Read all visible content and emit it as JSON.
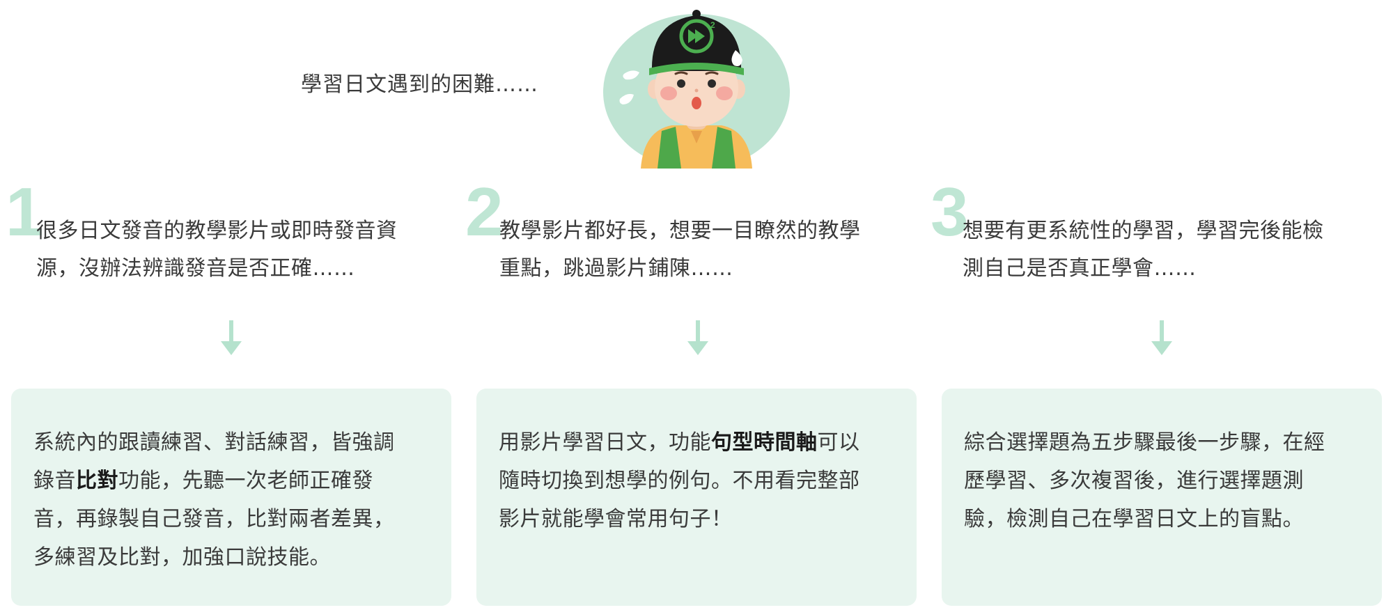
{
  "intro": "學習日文遇到的困難……",
  "colors": {
    "mint_circle": "#bfe4d3",
    "number": "#bfe6d4",
    "card_bg": "#e8f5ef",
    "arrow": "#b5e2cd",
    "hat": "#1b1b1b",
    "logo_green": "#4caf50"
  },
  "icons": {
    "avatar": "boy-with-cap-avatar",
    "arrow": "arrow-down-icon"
  },
  "columns": [
    {
      "number": "1",
      "problem_lines": [
        "很多日文發音的教學影片或即時發音資",
        "源，沒辦法辨識發音是否正確……"
      ],
      "solution": {
        "l1": "系統內的跟讀練習、對話練習，皆強調",
        "l2_pre": "錄音",
        "l2_bold": "比對",
        "l2_post": "功能，先聽一次老師正確發",
        "l3": "音，再錄製自己發音，比對兩者差異，",
        "l4": "多練習及比對，加強口說技能。"
      }
    },
    {
      "number": "2",
      "problem_lines": [
        "教學影片都好長，想要一目瞭然的教學",
        "重點，跳過影片鋪陳……"
      ],
      "solution": {
        "l1_pre": "用影片學習日文，功能",
        "l1_bold": "句型時間軸",
        "l1_post": "可以",
        "l2": "隨時切換到想學的例句。不用看完整部",
        "l3": "影片就能學會常用句子！"
      }
    },
    {
      "number": "3",
      "problem_lines": [
        "想要有更系統性的學習，學習完後能檢",
        "測自己是否真正學會……"
      ],
      "solution": {
        "l1": "綜合選擇題為五步驟最後一步驟，在經",
        "l2": "歷學習、多次複習後，進行選擇題測",
        "l3": "驗，檢測自己在學習日文上的盲點。"
      }
    }
  ]
}
